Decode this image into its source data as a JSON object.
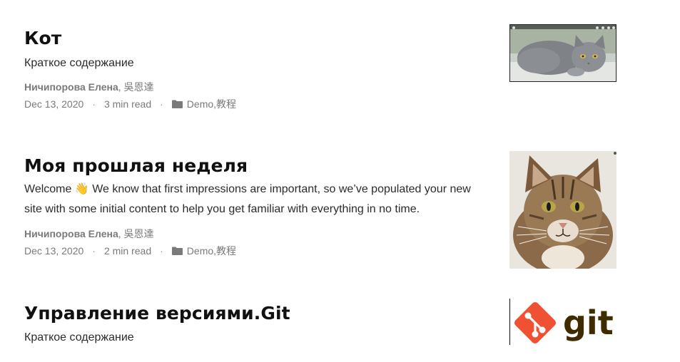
{
  "posts": [
    {
      "title": "Кот",
      "summary": "Краткое содержание",
      "author_main": "Ничипорова Елена",
      "author_sep": ", ",
      "author_second": "吳恩達",
      "date": "Dec 13, 2020",
      "read_time": "3 min read",
      "meta_sep": "·",
      "category_1": "Demo",
      "category_sep": ", ",
      "category_2": "教程",
      "thumbnail": "grey-cat-image"
    },
    {
      "title": "Моя прошлая неделя",
      "summary_line_1": "Welcome 👋 We know that first impressions are important, so we’ve populated your new",
      "summary_line_2": "site with some initial content to help you get familiar with everything in no time.",
      "author_main": "Ничипорова Елена",
      "author_sep": ", ",
      "author_second": "吳恩達",
      "date": "Dec 13, 2020",
      "read_time": "2 min read",
      "meta_sep": "·",
      "category_1": "Demo",
      "category_sep": ", ",
      "category_2": "教程",
      "thumbnail": "tabby-cat-image"
    },
    {
      "title": "Управление версиями.Git",
      "summary": "Краткое содержание",
      "thumbnail": "git-logo-image",
      "logo_text": "git"
    }
  ],
  "colors": {
    "title": "#111111",
    "text": "#2b2b2b",
    "meta": "#7a7a7a",
    "git_orange": "#f05133",
    "git_dark": "#3e2c00"
  }
}
